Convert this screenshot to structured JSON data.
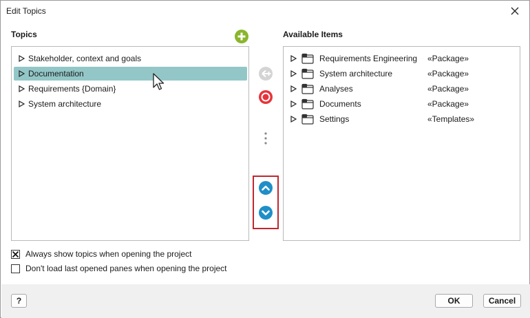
{
  "window": {
    "title": "Edit Topics"
  },
  "topics": {
    "heading": "Topics",
    "items": [
      {
        "label": "Stakeholder, context and goals"
      },
      {
        "label": "Documentation"
      },
      {
        "label": "Requirements {Domain}"
      },
      {
        "label": "System architecture"
      }
    ]
  },
  "available": {
    "heading": "Available Items",
    "items": [
      {
        "label": "Requirements Engineering",
        "stereotype": "«Package»"
      },
      {
        "label": "System architecture",
        "stereotype": "«Package»"
      },
      {
        "label": "Analyses",
        "stereotype": "«Package»"
      },
      {
        "label": "Documents",
        "stereotype": "«Package»"
      },
      {
        "label": "Settings",
        "stereotype": "«Templates»"
      }
    ]
  },
  "options": {
    "always_show_topics": {
      "label": "Always show topics when opening the project",
      "checked": true
    },
    "dont_load_panes": {
      "label": "Don't load last opened panes when opening the project",
      "checked": false
    }
  },
  "footer": {
    "help_label": "?",
    "ok_label": "OK",
    "cancel_label": "Cancel"
  },
  "colors": {
    "selection": "#93c7c7",
    "add_green": "#8ab62a",
    "remove_red": "#e8333a",
    "move_blue": "#1f8fc8",
    "highlight_red": "#c0262d"
  }
}
